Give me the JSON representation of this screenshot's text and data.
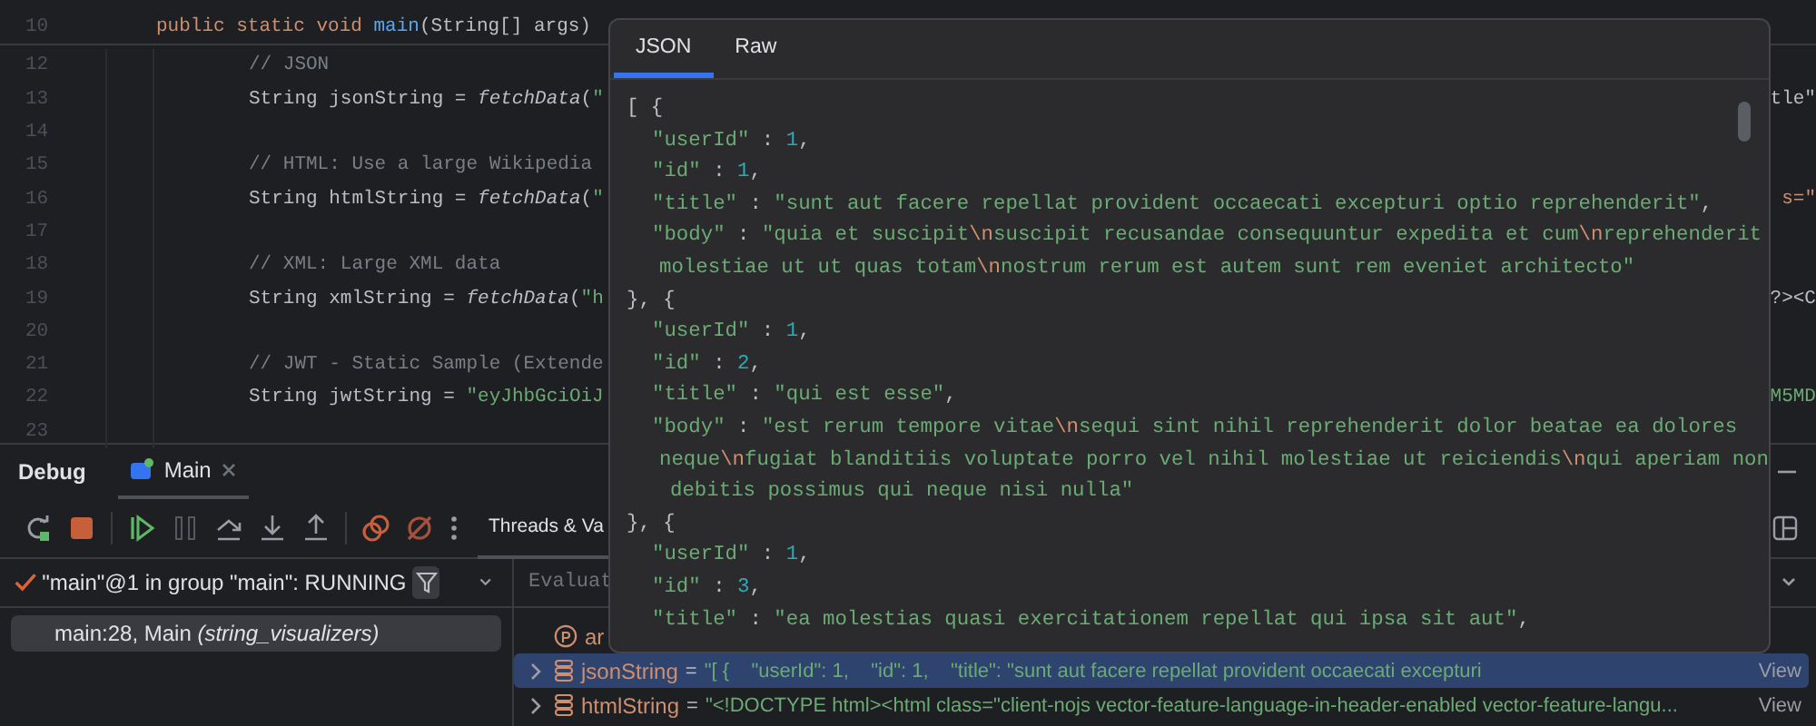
{
  "editor": {
    "lines": [
      {
        "number": "10",
        "segments": [
          {
            "kind": "keyword",
            "text": "public static void "
          },
          {
            "kind": "method",
            "text": "main"
          },
          {
            "kind": "plain",
            "text": "(String[] args)"
          }
        ],
        "children": [
          {
            "number": "12",
            "segments": [
              {
                "kind": "comment",
                "text": "// JSON"
              }
            ]
          },
          {
            "number": "13",
            "segments": [
              {
                "kind": "plain",
                "text": "String jsonString = "
              },
              {
                "kind": "call",
                "text": "fetchData"
              },
              {
                "kind": "plain",
                "text": "("
              },
              {
                "kind": "string",
                "text": "\""
              }
            ],
            "tail": {
              "kind": "plain",
              "text": "tle\""
            }
          },
          {
            "number": "14"
          },
          {
            "number": "15",
            "segments": [
              {
                "kind": "comment",
                "text": "// HTML: Use a large Wikipedia"
              }
            ]
          },
          {
            "number": "16",
            "segments": [
              {
                "kind": "plain",
                "text": "String htmlString = "
              },
              {
                "kind": "call",
                "text": "fetchData"
              },
              {
                "kind": "plain",
                "text": "("
              },
              {
                "kind": "string",
                "text": "\""
              }
            ],
            "tail": {
              "kind": "keyword",
              "text": "s=\""
            }
          },
          {
            "number": "17"
          },
          {
            "number": "18",
            "segments": [
              {
                "kind": "comment",
                "text": "// XML: Large XML data"
              }
            ]
          },
          {
            "number": "19",
            "segments": [
              {
                "kind": "plain",
                "text": "String xmlString = "
              },
              {
                "kind": "call",
                "text": "fetchData"
              },
              {
                "kind": "plain",
                "text": "("
              },
              {
                "kind": "string",
                "text": "\"h"
              }
            ],
            "tail": {
              "kind": "plain",
              "text": "?><C"
            }
          },
          {
            "number": "20"
          },
          {
            "number": "21",
            "segments": [
              {
                "kind": "comment",
                "text": "// JWT - Static Sample (Extende"
              }
            ]
          },
          {
            "number": "22",
            "segments": [
              {
                "kind": "plain",
                "text": "String jwtString = "
              },
              {
                "kind": "string",
                "text": "\"eyJhbGciOiJ"
              }
            ],
            "tail": {
              "kind": "string",
              "text": "M5MD"
            }
          },
          {
            "number": "23"
          }
        ]
      }
    ]
  },
  "popup": {
    "tabs": [
      {
        "label": "JSON",
        "selected": true
      },
      {
        "label": "Raw",
        "selected": false
      }
    ],
    "lines": [
      {
        "kind": "bracket",
        "segments": [
          {
            "kind": "punct",
            "text": "[ {"
          }
        ]
      },
      {
        "kind": "entry",
        "segments": [
          {
            "kind": "key",
            "text": "\"userId\""
          },
          {
            "kind": "punct",
            "text": " : "
          },
          {
            "kind": "number",
            "text": "1"
          },
          {
            "kind": "punct",
            "text": ","
          }
        ]
      },
      {
        "kind": "entry",
        "segments": [
          {
            "kind": "key",
            "text": "\"id\""
          },
          {
            "kind": "punct",
            "text": " : "
          },
          {
            "kind": "number",
            "text": "1"
          },
          {
            "kind": "punct",
            "text": ","
          }
        ]
      },
      {
        "kind": "entry",
        "segments": [
          {
            "kind": "key",
            "text": "\"title\""
          },
          {
            "kind": "punct",
            "text": " : "
          },
          {
            "kind": "string",
            "text": "\"sunt aut facere repellat provident occaecati excepturi optio reprehenderit\""
          },
          {
            "kind": "punct",
            "text": ","
          }
        ]
      },
      {
        "kind": "entry",
        "segments": [
          {
            "kind": "key",
            "text": "\"body\""
          },
          {
            "kind": "punct",
            "text": " : "
          },
          {
            "kind": "string",
            "text": "\"quia et suscipit"
          },
          {
            "kind": "escape",
            "text": "\\n"
          },
          {
            "kind": "string",
            "text": "suscipit recusandae consequuntur expedita et cum"
          },
          {
            "kind": "escape",
            "text": "\\n"
          },
          {
            "kind": "string",
            "text": "reprehenderit"
          }
        ]
      },
      {
        "kind": "wrap",
        "segments": [
          {
            "kind": "string",
            "text": "molestiae ut ut quas totam"
          },
          {
            "kind": "escape",
            "text": "\\n"
          },
          {
            "kind": "string",
            "text": "nostrum rerum est autem sunt rem eveniet architecto\""
          }
        ]
      },
      {
        "kind": "bracket",
        "segments": [
          {
            "kind": "punct",
            "text": "}, {"
          }
        ]
      },
      {
        "kind": "entry",
        "segments": [
          {
            "kind": "key",
            "text": "\"userId\""
          },
          {
            "kind": "punct",
            "text": " : "
          },
          {
            "kind": "number",
            "text": "1"
          },
          {
            "kind": "punct",
            "text": ","
          }
        ]
      },
      {
        "kind": "entry",
        "segments": [
          {
            "kind": "key",
            "text": "\"id\""
          },
          {
            "kind": "punct",
            "text": " : "
          },
          {
            "kind": "number",
            "text": "2"
          },
          {
            "kind": "punct",
            "text": ","
          }
        ]
      },
      {
        "kind": "entry",
        "segments": [
          {
            "kind": "key",
            "text": "\"title\""
          },
          {
            "kind": "punct",
            "text": " : "
          },
          {
            "kind": "string",
            "text": "\"qui est esse\""
          },
          {
            "kind": "punct",
            "text": ","
          }
        ]
      },
      {
        "kind": "entry",
        "segments": [
          {
            "kind": "key",
            "text": "\"body\""
          },
          {
            "kind": "punct",
            "text": " : "
          },
          {
            "kind": "string",
            "text": "\"est rerum tempore vitae"
          },
          {
            "kind": "escape",
            "text": "\\n"
          },
          {
            "kind": "string",
            "text": "sequi sint nihil reprehenderit dolor beatae ea dolores"
          }
        ]
      },
      {
        "kind": "wrap",
        "segments": [
          {
            "kind": "string",
            "text": "neque"
          },
          {
            "kind": "escape",
            "text": "\\n"
          },
          {
            "kind": "string",
            "text": "fugiat blanditiis voluptate porro vel nihil molestiae ut reiciendis"
          },
          {
            "kind": "escape",
            "text": "\\n"
          },
          {
            "kind": "string",
            "text": "qui aperiam non"
          }
        ]
      },
      {
        "kind": "wrap2",
        "segments": [
          {
            "kind": "string",
            "text": "debitis possimus qui neque nisi nulla\""
          }
        ]
      },
      {
        "kind": "bracket",
        "segments": [
          {
            "kind": "punct",
            "text": "}, {"
          }
        ]
      },
      {
        "kind": "entry",
        "segments": [
          {
            "kind": "key",
            "text": "\"userId\""
          },
          {
            "kind": "punct",
            "text": " : "
          },
          {
            "kind": "number",
            "text": "1"
          },
          {
            "kind": "punct",
            "text": ","
          }
        ]
      },
      {
        "kind": "entry",
        "segments": [
          {
            "kind": "key",
            "text": "\"id\""
          },
          {
            "kind": "punct",
            "text": " : "
          },
          {
            "kind": "number",
            "text": "3"
          },
          {
            "kind": "punct",
            "text": ","
          }
        ]
      },
      {
        "kind": "entry",
        "segments": [
          {
            "kind": "key",
            "text": "\"title\""
          },
          {
            "kind": "punct",
            "text": " : "
          },
          {
            "kind": "string",
            "text": "\"ea molestias quasi exercitationem repellat qui ipsa sit aut\""
          },
          {
            "kind": "punct",
            "text": ","
          }
        ]
      }
    ]
  },
  "debug": {
    "title": "Debug",
    "tabs": [
      {
        "label": "Main",
        "selected": true
      }
    ],
    "side_tab": {
      "label": "Threads & Va",
      "selected": true
    },
    "thread": {
      "label": "\"main\"@1 in group \"main\": RUNNING"
    },
    "frames": [
      {
        "text": "main:28, Main *(string_visualizers)*",
        "selected": true
      }
    ],
    "evaluate": {
      "placeholder": "Evaluat"
    },
    "variables": [
      {
        "kind": "parameter",
        "name": "ar",
        "expandable": false,
        "selected": false
      },
      {
        "kind": "field",
        "name": "jsonString",
        "operator": "=",
        "value": "\"[ {    \"userId\": 1,    \"id\": 1,    \"title\": \"sunt aut facere repellat provident occaecati excepturi",
        "link": "View",
        "expandable": true,
        "selected": true
      },
      {
        "kind": "field",
        "name": "htmlString",
        "operator": "=",
        "value": "\"<!DOCTYPE html><html class=\"client-nojs vector-feature-language-in-header-enabled vector-feature-langu...",
        "link": "View",
        "expandable": true,
        "selected": false
      }
    ]
  }
}
